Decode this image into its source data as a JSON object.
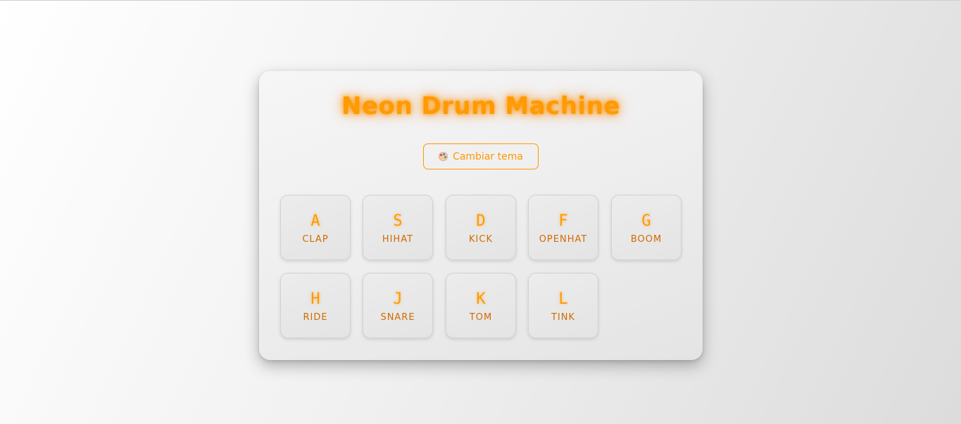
{
  "app": {
    "title": "Neon Drum Machine"
  },
  "theme_button": {
    "label": "Cambiar tema",
    "icon": "palette-icon"
  },
  "pads": [
    {
      "key": "A",
      "sound": "CLAP"
    },
    {
      "key": "S",
      "sound": "HIHAT"
    },
    {
      "key": "D",
      "sound": "KICK"
    },
    {
      "key": "F",
      "sound": "OPENHAT"
    },
    {
      "key": "G",
      "sound": "BOOM"
    },
    {
      "key": "H",
      "sound": "RIDE"
    },
    {
      "key": "J",
      "sound": "SNARE"
    },
    {
      "key": "K",
      "sound": "TOM"
    },
    {
      "key": "L",
      "sound": "TINK"
    }
  ],
  "colors": {
    "accent": "#ff9a00",
    "sound_label": "#d26a00",
    "panel": "#eeeeee"
  }
}
